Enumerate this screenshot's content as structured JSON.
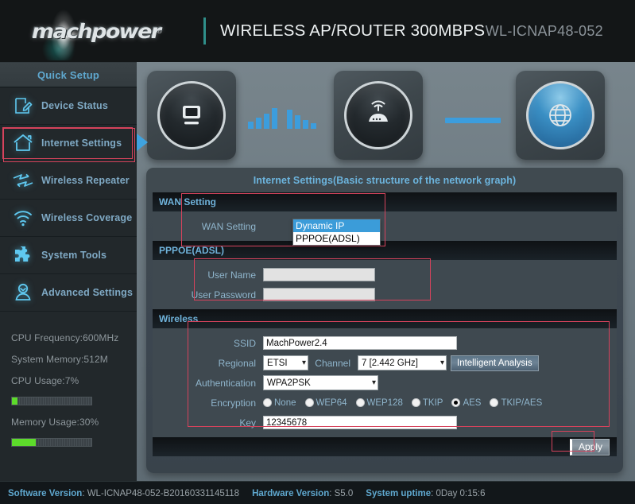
{
  "header": {
    "logo_text": "machpower",
    "logo_registered": "®",
    "title": "WIRELESS AP/ROUTER 300MBPS",
    "model": "WL-ICNAP48-052"
  },
  "sidebar": {
    "quick_setup": "Quick Setup",
    "items": [
      {
        "label": "Device Status",
        "icon": "edit-document-icon",
        "active": false
      },
      {
        "label": "Internet Settings",
        "icon": "home-icon",
        "active": true
      },
      {
        "label": "Wireless Repeater",
        "icon": "repeater-arrows-icon",
        "active": false
      },
      {
        "label": "Wireless Coverage",
        "icon": "wifi-signal-icon",
        "active": false
      },
      {
        "label": "System Tools",
        "icon": "puzzle-piece-icon",
        "active": false
      },
      {
        "label": "Advanced Settings",
        "icon": "user-person-icon",
        "active": false
      }
    ],
    "stats": {
      "cpu_frequency": "CPU Frequency:600MHz",
      "system_memory": "System Memory:512M",
      "cpu_usage_label": "CPU Usage:7%",
      "cpu_usage_percent": 7,
      "memory_usage_label": "Memory Usage:30%",
      "memory_usage_percent": 30,
      "bar_color": "#5ddb2b"
    }
  },
  "topology": {
    "nodes": [
      {
        "name": "client-computer-icon"
      },
      {
        "name": "router-icon"
      },
      {
        "name": "internet-globe-icon"
      }
    ],
    "signal_bars_icon": "wifi-bars-icon",
    "link_icon": "connection-line-icon"
  },
  "panel": {
    "title": "Internet Settings(Basic structure of the network graph)",
    "sections": {
      "wan": {
        "band_label": "WAN Setting",
        "field_label": "WAN Setting",
        "selected_value": "Dynamic IP",
        "options": [
          "Dynamic IP",
          "PPPOE(ADSL)"
        ]
      },
      "pppoe": {
        "band_label": "PPPOE(ADSL)",
        "user_name_label": "User Name",
        "user_name_value": "",
        "user_password_label": "User Password",
        "user_password_value": ""
      },
      "wireless": {
        "band_label": "Wireless",
        "ssid_label": "SSID",
        "ssid_value": "MachPower2.4",
        "regional_label": "Regional",
        "regional_value": "ETSI",
        "channel_label": "Channel",
        "channel_value": "7 [2.442 GHz]",
        "intelligent_analysis_label": "Intelligent Analysis",
        "authentication_label": "Authentication",
        "authentication_value": "WPA2PSK",
        "encryption_label": "Encryption",
        "encryption_options": [
          {
            "label": "None",
            "selected": false
          },
          {
            "label": "WEP64",
            "selected": false
          },
          {
            "label": "WEP128",
            "selected": false
          },
          {
            "label": "TKIP",
            "selected": false
          },
          {
            "label": "AES",
            "selected": true
          },
          {
            "label": "TKIP/AES",
            "selected": false
          }
        ],
        "key_label": "Key",
        "key_value": "12345678"
      }
    },
    "apply_label": "Apply"
  },
  "footer": {
    "software_version_key": "Software Version",
    "software_version_value": ": WL-ICNAP48-052-B20160331145118",
    "hardware_version_key": "Hardware Version",
    "hardware_version_value": ": S5.0",
    "uptime_key": "System uptime",
    "uptime_value": ": 0Day 0:15:6"
  },
  "annotation_color": "#d6435c"
}
